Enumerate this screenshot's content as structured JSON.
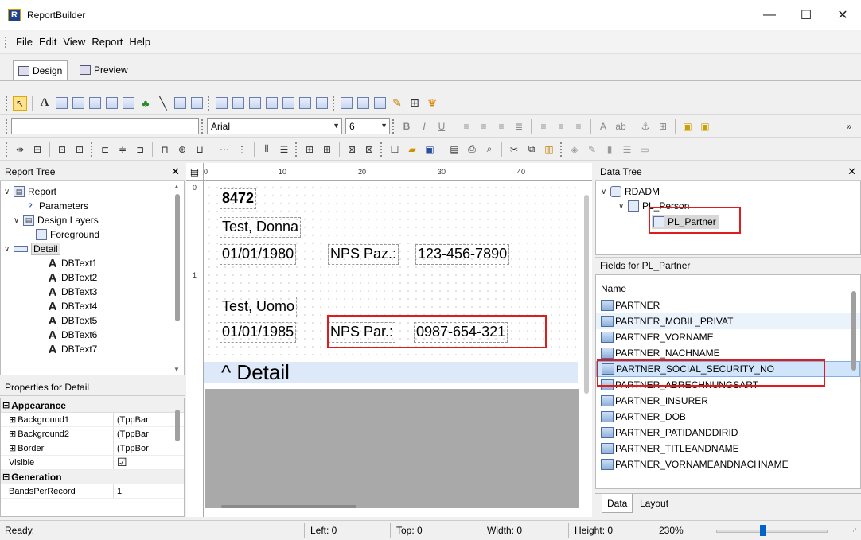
{
  "window": {
    "app_icon_letter": "R",
    "title": "ReportBuilder",
    "minimize": "—",
    "maximize": "☐",
    "close": "✕"
  },
  "menu": [
    "File",
    "Edit",
    "View",
    "Report",
    "Help"
  ],
  "tabs": {
    "design": "Design",
    "preview": "Preview"
  },
  "format_toolbar": {
    "font_name": "Arial",
    "font_size": "6"
  },
  "report_tree": {
    "title": "Report Tree",
    "items": [
      {
        "label": "Report",
        "level": 0
      },
      {
        "label": "Parameters",
        "level": 1
      },
      {
        "label": "Design Layers",
        "level": 1
      },
      {
        "label": "Foreground",
        "level": 2
      },
      {
        "label": "Detail",
        "level": 0
      },
      {
        "label": "DBText1",
        "level": 2
      },
      {
        "label": "DBText2",
        "level": 2
      },
      {
        "label": "DBText3",
        "level": 2
      },
      {
        "label": "DBText4",
        "level": 2
      },
      {
        "label": "DBText5",
        "level": 2
      },
      {
        "label": "DBText6",
        "level": 2
      },
      {
        "label": "DBText7",
        "level": 2
      }
    ]
  },
  "properties": {
    "title": "Properties for Detail",
    "categories": [
      {
        "name": "Appearance",
        "rows": [
          {
            "name": "Background1",
            "value": "(TppBar",
            "expandable": true
          },
          {
            "name": "Background2",
            "value": "(TppBar",
            "expandable": true
          },
          {
            "name": "Border",
            "value": "(TppBor",
            "expandable": true
          },
          {
            "name": "Visible",
            "value": "☑",
            "expandable": false
          }
        ]
      },
      {
        "name": "Generation",
        "rows": [
          {
            "name": "BandsPerRecord",
            "value": "1",
            "expandable": false
          }
        ]
      }
    ]
  },
  "ruler": {
    "marks": [
      "0",
      "10",
      "20",
      "30",
      "40"
    ]
  },
  "vruler": {
    "marks": [
      "0",
      "1"
    ]
  },
  "design": {
    "f1": "8472",
    "f2": "Test, Donna",
    "f3": "01/01/1980",
    "f4": "NPS Paz.:",
    "f5": "123-456-7890",
    "f6": "Test, Uomo",
    "f7": "01/01/1985",
    "f8": "NPS Par.:",
    "f9": "0987-654-321",
    "band_label": "^  Detail"
  },
  "data_tree": {
    "title": "Data Tree",
    "root": "RDADM",
    "child": "PL_Person",
    "grandchild": "PL_Partner"
  },
  "fields": {
    "title": "Fields for PL_Partner",
    "column": "Name",
    "items": [
      "PARTNER",
      "PARTNER_MOBIL_PRIVAT",
      "PARTNER_VORNAME",
      "PARTNER_NACHNAME",
      "PARTNER_SOCIAL_SECURITY_NO",
      "PARTNER_ABRECHNUNGSART",
      "PARTNER_INSURER",
      "PARTNER_DOB",
      "PARTNER_PATIDANDDIRID",
      "PARTNER_TITLEANDNAME",
      "PARTNER_VORNAMEANDNACHNAME"
    ]
  },
  "right_tabs": {
    "data": "Data",
    "layout": "Layout"
  },
  "status": {
    "ready": "Ready.",
    "left": "Left: 0",
    "top": "Top: 0",
    "width": "Width: 0",
    "height": "Height: 0",
    "zoom": "230%"
  },
  "colors": {
    "highlight": "#e01b1b",
    "band": "#dde9f9",
    "selection": "#d0e5fb"
  }
}
